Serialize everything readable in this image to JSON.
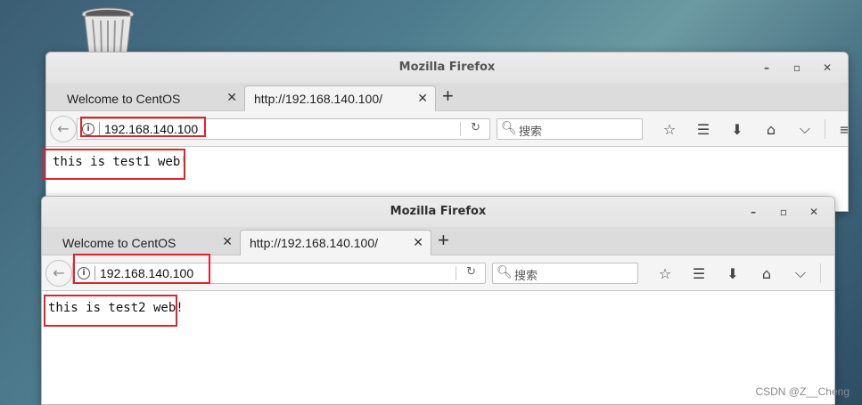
{
  "desktop": {
    "trash_icon": "trash-icon"
  },
  "windows": [
    {
      "title": "Mozilla Firefox",
      "controls": {
        "minimize": "–",
        "maximize": "▫",
        "close": "✕"
      },
      "tabs": [
        {
          "label": "Welcome to CentOS",
          "close": "✕"
        },
        {
          "label": "http://192.168.140.100/",
          "close": "✕"
        }
      ],
      "new_tab": "+",
      "address": "192.168.140.100",
      "search_placeholder": "搜索",
      "page_text": "this is test1 web!"
    },
    {
      "title": "Mozilla Firefox",
      "controls": {
        "minimize": "–",
        "maximize": "▫",
        "close": "✕"
      },
      "tabs": [
        {
          "label": "Welcome to CentOS",
          "close": "✕"
        },
        {
          "label": "http://192.168.140.100/",
          "close": "✕"
        }
      ],
      "new_tab": "+",
      "address": "192.168.140.100",
      "search_placeholder": "搜索",
      "page_text": "this is test2 web!"
    }
  ],
  "watermark": "CSDN @Z__Cheng",
  "colors": {
    "highlight": "#e0222c"
  }
}
